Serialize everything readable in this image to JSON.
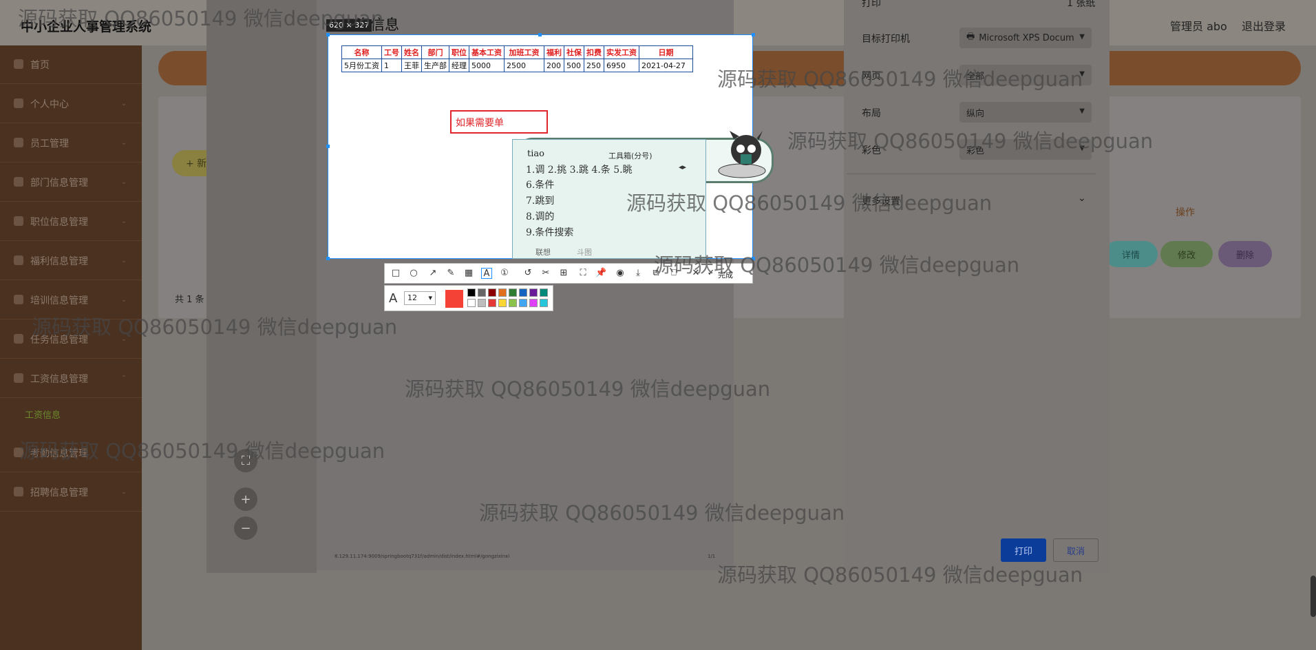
{
  "app": {
    "title": "中小企业人事管理系统",
    "admin": "管理员 abo",
    "logout": "退出登录"
  },
  "sidebar": {
    "items": [
      {
        "label": "首页"
      },
      {
        "label": "个人中心"
      },
      {
        "label": "员工管理"
      },
      {
        "label": "部门信息管理"
      },
      {
        "label": "职位信息管理"
      },
      {
        "label": "福利信息管理"
      },
      {
        "label": "培训信息管理"
      },
      {
        "label": "任务信息管理"
      },
      {
        "label": "工资信息管理"
      },
      {
        "label": "考勤信息管理"
      },
      {
        "label": "招聘信息管理"
      }
    ],
    "sub_item": "工资信息"
  },
  "page": {
    "title": "工资信息",
    "total": "共 1 条",
    "add": "+ 新",
    "ops_header": "操作",
    "row_buttons": {
      "detail": "详情",
      "edit": "修改",
      "delete": "删除"
    }
  },
  "print": {
    "printer_label": "打印",
    "printer_value": "1 张纸",
    "target_label": "目标打印机",
    "target_value": "Microsoft XPS Docum",
    "pages_label": "网页",
    "pages_value": "全部",
    "layout_label": "布局",
    "layout_value": "纵向",
    "color_label": "彩色",
    "color_value": "彩色",
    "more_label": "更多设置",
    "print_btn": "打印",
    "cancel_btn": "取消",
    "footer_url": "8.129.11.174:9009/springbootq731f/admin/dist/index.html#/gongzixinxi",
    "footer_page": "1/1"
  },
  "snip": {
    "size": "620 × 327",
    "textbox": "如果需要单"
  },
  "salary_table": {
    "headers": [
      "名称",
      "工号",
      "姓名",
      "部门",
      "职位",
      "基本工资",
      "加班工资",
      "福利",
      "社保",
      "扣费",
      "实发工资",
      "日期"
    ],
    "rows": [
      [
        "5月份工资",
        "1",
        "王菲",
        "生产部",
        "经理",
        "5000",
        "2500",
        "200",
        "500",
        "250",
        "6950",
        "2021-04-27"
      ]
    ]
  },
  "ime": {
    "pinyin": "tiao",
    "toolbox": "工具箱(分号)",
    "line1": "1.调  2.挑  3.跳  4.条  5.眺",
    "cand6": "6.条件",
    "cand7": "7.跳到",
    "cand8": "8.调的",
    "cand9": "9.条件搜索",
    "foot1": "联想",
    "foot2": "斗图"
  },
  "toolbar": {
    "done": "完成",
    "font_size": "12",
    "colors": [
      "#000000",
      "#666666",
      "#8b0000",
      "#e07020",
      "#2e7d32",
      "#1565c0",
      "#6a1b9a",
      "#00897b",
      "#ffffff",
      "#bdbdbd",
      "#e53935",
      "#fdd835",
      "#8bc34a",
      "#42a5f5",
      "#e040fb",
      "#26c6da"
    ],
    "active_color": "#f44336"
  },
  "watermark": "源码获取 QQ86050149 微信deepguan"
}
